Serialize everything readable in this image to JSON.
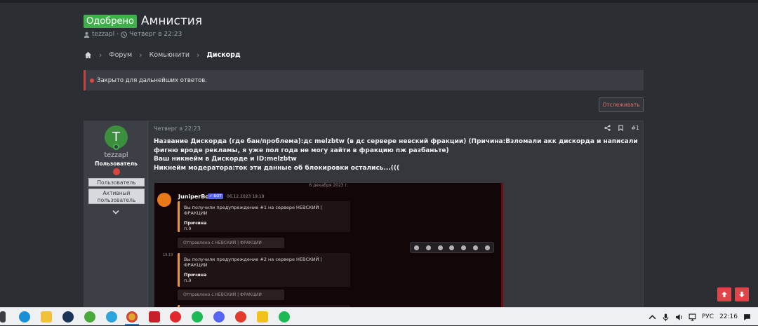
{
  "thread": {
    "status_badge": "Одобрено",
    "title": "Амнистия",
    "author": "tezzapl",
    "date": "Четверг в 22:23"
  },
  "breadcrumb": {
    "items": [
      "Форум",
      "Комьюнити",
      "Дискорд"
    ]
  },
  "notice": {
    "closed_text": "Закрыто для дальнейших ответов."
  },
  "actions": {
    "watch_label": "Отслеживать"
  },
  "post": {
    "date": "Четверг в 22:23",
    "number": "#1",
    "user": {
      "avatar_letter": "T",
      "name": "tezzapl",
      "role": "Пользователь",
      "banner_1": "Пользователь",
      "banner_2": "Активный пользователь"
    },
    "message_lines": [
      "Название Дискорда (где бан/проблема):дс melzbtw (в дс сервере невский фракции) (Причина:Взломали акк дискорда и написали фигню вроде рекламы, я уже пол года не могу зайти в фракцию пж разбаньте)",
      "Ваш никнейм в Дискорде и ID:melzbtw",
      "Никнейм модератора:ток эти данные об блокировки остались...((("
    ]
  },
  "attachment": {
    "date_divider": "6 декабря 2023 г.",
    "bot_name": "JuniperBot",
    "bot_tag": "✓ БОТ",
    "bot_time": "06.12.2023 19:19",
    "warn_1": "Вы получили предупреждение #1 на сервере НЕВСКИЙ | ФРАКЦИИ",
    "warn_2": "Вы получили предупреждение #2 на сервере НЕВСКИЙ | ФРАКЦИИ",
    "reason_label": "Причина",
    "reason_value": "п.9",
    "sent_from": "Отправлено с НЕВСКИЙ | ФРАКЦИИ",
    "time_small": "19:19"
  },
  "taskbar": {
    "lang": "РУС",
    "time": "22:16"
  },
  "colors": {
    "approved": "#3fb04a",
    "accent_red": "#e0454a",
    "avatar": "#3c8f3c"
  }
}
